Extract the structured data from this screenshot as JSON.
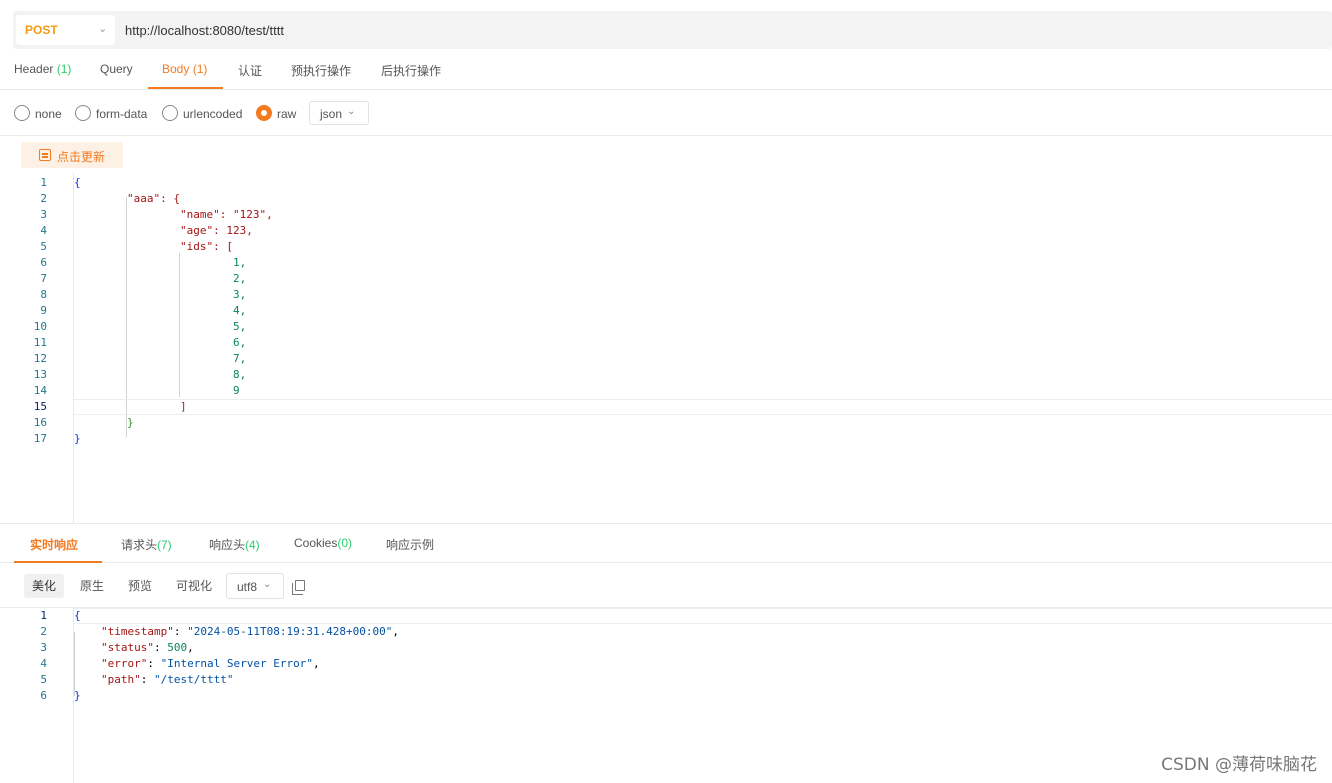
{
  "request": {
    "method": "POST",
    "url": "http://localhost:8080/test/tttt"
  },
  "request_tabs": [
    {
      "label": "Header",
      "count": "(1)"
    },
    {
      "label": "Query",
      "count": ""
    },
    {
      "label": "Body",
      "count": "(1)",
      "active": true
    },
    {
      "label": "认证",
      "count": ""
    },
    {
      "label": "预执行操作",
      "count": ""
    },
    {
      "label": "后执行操作",
      "count": ""
    }
  ],
  "body_types": [
    "none",
    "form-data",
    "urlencoded",
    "raw"
  ],
  "body_type_selected": "raw",
  "body_format": "json",
  "update_button": "点击更新",
  "request_editor": {
    "line_numbers": [
      "1",
      "2",
      "3",
      "4",
      "5",
      "6",
      "7",
      "8",
      "9",
      "10",
      "11",
      "12",
      "13",
      "14",
      "15",
      "16",
      "17"
    ],
    "current_line": 15,
    "lines": [
      "{",
      "\"aaa\": {",
      "\"name\": \"123\",",
      "\"age\": 123,",
      "\"ids\": [",
      "1,",
      "2,",
      "3,",
      "4,",
      "5,",
      "6,",
      "7,",
      "8,",
      "9",
      "]",
      "}",
      "}"
    ]
  },
  "response_tabs": [
    {
      "label": "实时响应",
      "count": "",
      "active": true
    },
    {
      "label": "请求头",
      "count": "(7)"
    },
    {
      "label": "响应头",
      "count": "(4)"
    },
    {
      "label": "Cookies",
      "count": "(0)"
    },
    {
      "label": "响应示例",
      "count": ""
    }
  ],
  "view_modes": [
    "美化",
    "原生",
    "预览",
    "可视化"
  ],
  "view_mode_selected": "美化",
  "encoding": "utf8",
  "response_editor": {
    "line_numbers": [
      "1",
      "2",
      "3",
      "4",
      "5",
      "6"
    ],
    "timestamp": "2024-05-11T08:19:31.428+00:00",
    "status": "500",
    "error": "Internal Server Error",
    "path": "/test/tttt"
  },
  "watermark": "CSDN @薄荷味脑花",
  "colors": {
    "accent": "#f47a20",
    "method": "#f39c12",
    "count": "#2ecc71"
  }
}
